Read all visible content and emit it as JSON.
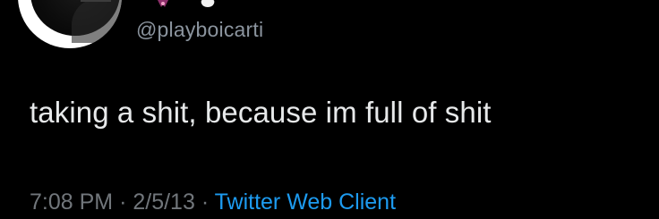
{
  "tweet": {
    "handle": "@playboicarti",
    "text": "taking a shit, because im full of shit",
    "time": "7:08 PM",
    "separator": "·",
    "date": "2/5/13",
    "client": "Twitter Web Client"
  },
  "icons": {
    "badge_1": "vampire-emoji-icon",
    "badge_2": "cloud-icon"
  },
  "colors": {
    "background": "#000000",
    "text": "#e7e9ea",
    "secondary": "#71767b",
    "link": "#1d9bf0"
  }
}
